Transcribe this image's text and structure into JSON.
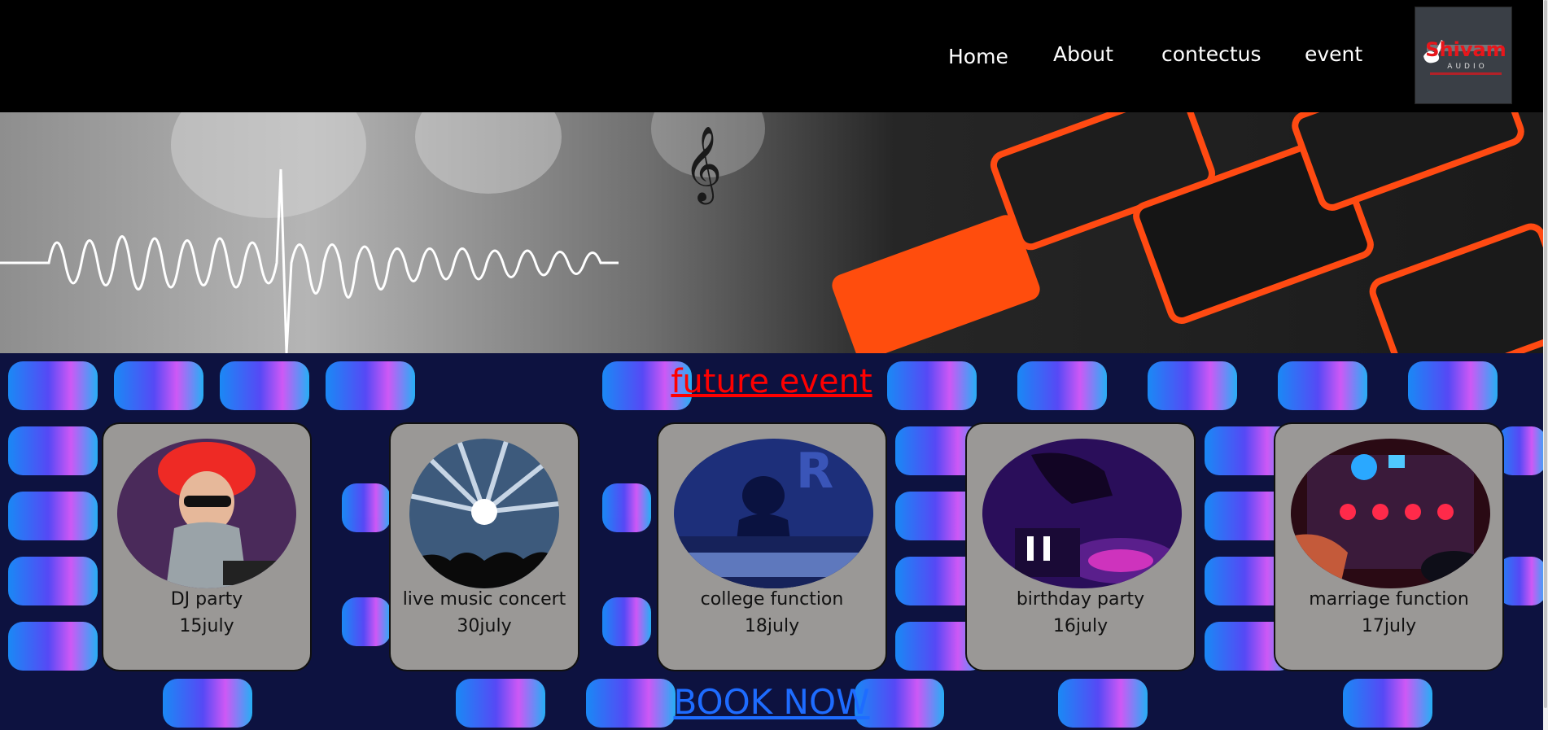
{
  "nav": {
    "items": [
      {
        "label": "Home"
      },
      {
        "label": "About"
      },
      {
        "label": "contectus"
      },
      {
        "label": "event"
      }
    ],
    "logo": {
      "text": "Shivam",
      "subtext": "AUDIO"
    }
  },
  "section": {
    "title": "future event"
  },
  "events": [
    {
      "name": "DJ party",
      "date": "15july"
    },
    {
      "name": "live music concert",
      "date": "30july"
    },
    {
      "name": "college function",
      "date": "18july"
    },
    {
      "name": "birthday party",
      "date": "16july"
    },
    {
      "name": "marriage function",
      "date": "17july"
    }
  ],
  "cta": {
    "label": "BOOK NOW"
  },
  "colors": {
    "nav_bg": "#000000",
    "title": "#ff0000",
    "card_bg": "#9a9896",
    "link": "#1e6cff"
  }
}
